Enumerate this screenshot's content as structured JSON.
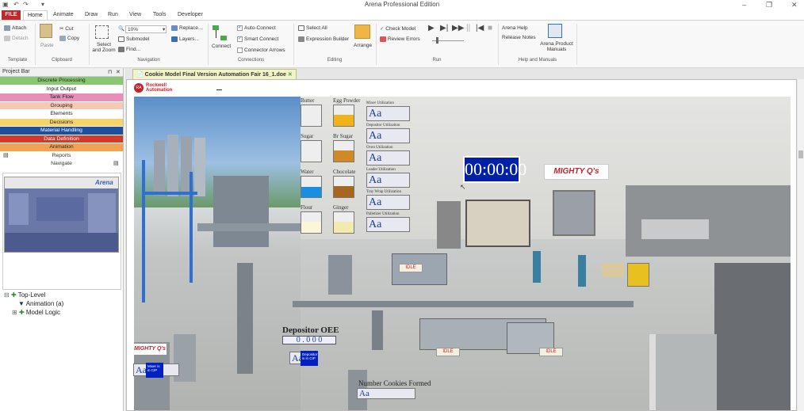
{
  "window": {
    "title": "Arena Professional Edition",
    "min": "–",
    "restore": "❐",
    "close": "✕"
  },
  "tabs": [
    "FILE",
    "Home",
    "Animate",
    "Draw",
    "Run",
    "View",
    "Tools",
    "Developer"
  ],
  "ribbon": {
    "attach": "Attach",
    "detach": "Detach",
    "template_group": "Template",
    "paste": "Paste",
    "cut": "Cut",
    "copy": "Copy",
    "clipboard_group": "Clipboard",
    "select_zoom": "Select and Zoom",
    "zoom_value": "10%",
    "submodel": "Submodel",
    "find": "Find...",
    "replace": "Replace...",
    "layers": "Layers...",
    "navigation_group": "Navigation",
    "connect": "Connect",
    "auto_connect": "Auto-Connect",
    "smart_connect": "Smart Connect",
    "connector_arrows": "Connector Arrows",
    "connections_group": "Connections",
    "select_all": "Select All",
    "expression_builder": "Expression Builder",
    "arrange": "Arrange",
    "editing_group": "Editing",
    "check_model": "Check Model",
    "review_errors": "Review Errors",
    "run_group": "Run",
    "arena_help": "Arena Help",
    "release_notes": "Release Notes",
    "product_manuals": "Arena Product Manuals",
    "help_group": "Help and Manuals"
  },
  "project_bar": {
    "title": "Project Bar",
    "pin": "⊓",
    "close": "✕",
    "panels": [
      {
        "label": "Discrete Processing",
        "color": "#88c873"
      },
      {
        "label": "Input Output",
        "color": "#ffffff"
      },
      {
        "label": "Tank Flow",
        "color": "#e88fb8"
      },
      {
        "label": "Grouping",
        "color": "#f7c9b3"
      },
      {
        "label": "Elements",
        "color": "#ffffff"
      },
      {
        "label": "Decisions",
        "color": "#f5d56a"
      },
      {
        "label": "Material Handling",
        "color": "#1d4f9e"
      },
      {
        "label": "Data Definition",
        "color": "#d33a2c"
      },
      {
        "label": "Animation",
        "color": "#f3a253"
      }
    ],
    "reports": "Reports",
    "navigate": "Navigate",
    "thumb_logo": "Arena",
    "tree": {
      "root": "Top-Level",
      "child1": "Animation (a)",
      "child2": "Model Logic"
    }
  },
  "document": {
    "tab": "Cookie Model Final Version Automation Fair 16_1.doe",
    "logo_line1": "Rockwell",
    "logo_line2": "Automation",
    "ingredients": [
      {
        "name": "Butter",
        "color": "#f5f0c8",
        "level": 0.0
      },
      {
        "name": "Egg Powder",
        "color": "#f2b21a",
        "level": 0.55
      },
      {
        "name": "Sugar",
        "color": "#ffffff",
        "level": 0.0
      },
      {
        "name": "Br Sugar",
        "color": "#cf8a27",
        "level": 0.55
      },
      {
        "name": "Water",
        "color": "#1a8ee0",
        "level": 0.5
      },
      {
        "name": "Chocolate",
        "color": "#a8661e",
        "level": 0.55
      },
      {
        "name": "Flour",
        "color": "#fbf6d8",
        "level": 0.55
      },
      {
        "name": "Ginger",
        "color": "#f3eab0",
        "level": 0.55
      }
    ],
    "utilization": [
      "Mixer Utilization",
      "Depositor Utilization",
      "Oven Utilization",
      "Loader Utilization",
      "Tray Wrap Utilization",
      "Palletizer Utilization"
    ],
    "aa": "Aa",
    "timer": "00:00:00",
    "brand": "MIGHTY Q's",
    "idle": "IDLE",
    "depositor_oee": "Depositor OEE",
    "oee_value": "0 . 0 0 0",
    "depositor_badge": "Depositor is in CIP",
    "mixer_badge": "Mixer is in CIP",
    "cookies_label": "Number Cookies Formed"
  }
}
